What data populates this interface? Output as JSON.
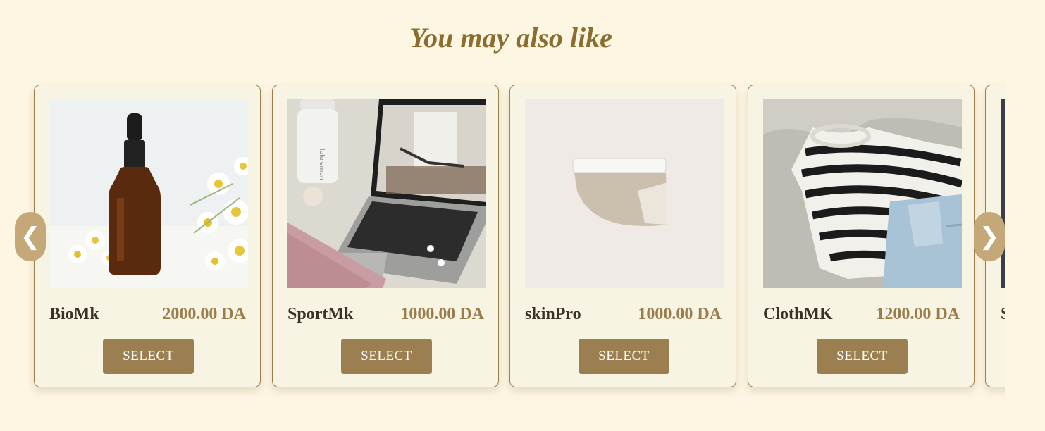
{
  "section": {
    "title": "You may also like"
  },
  "carousel": {
    "prev_icon": "❮",
    "next_icon": "❯",
    "products": [
      {
        "name": "BioMk",
        "price": "2000.00 DA",
        "select_label": "SELECT",
        "image": "serum-bottle-with-daisies"
      },
      {
        "name": "SportMk",
        "price": "1000.00 DA",
        "select_label": "SELECT",
        "image": "laptop-workout-flatlay"
      },
      {
        "name": "skinPro",
        "price": "1000.00 DA",
        "select_label": "SELECT",
        "image": "cream-jar"
      },
      {
        "name": "ClothMK",
        "price": "1200.00 DA",
        "select_label": "SELECT",
        "image": "striped-sweater-and-jeans"
      },
      {
        "name": "S",
        "price": "",
        "select_label": "",
        "image": "partial-product-image"
      }
    ]
  },
  "colors": {
    "background": "#fdf6e3",
    "accent": "#9b7f50",
    "title": "#8a6d2f",
    "arrow": "#c4a878"
  }
}
